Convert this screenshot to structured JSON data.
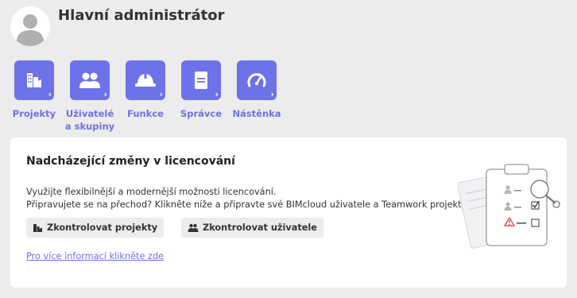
{
  "header": {
    "title": "Hlavní administrátor"
  },
  "nav": {
    "items": [
      {
        "label": "Projekty",
        "icon": "buildings-icon"
      },
      {
        "label": "Uživatelé a skupiny",
        "icon": "users-icon"
      },
      {
        "label": "Funkce",
        "icon": "hard-hat-icon"
      },
      {
        "label": "Správce",
        "icon": "server-icon"
      },
      {
        "label": "Nástěnka",
        "icon": "speedometer-icon"
      }
    ]
  },
  "license_card": {
    "title": "Nadcházející změny v licencování",
    "line1": "Využijte flexibilnější a modernější možnosti licencování.",
    "line2": "Připravujete se na přechod? Klikněte níže a připravte své BIMcloud uživatele a Teamwork projekty.",
    "check_projects_label": "Zkontrolovat projekty",
    "check_users_label": "Zkontrolovat uživatele",
    "more_info_link": "Pro více informací klikněte zde"
  },
  "colors": {
    "accent": "#6d72e8",
    "background": "#ececec",
    "card": "#ffffff",
    "warning": "#e05050"
  }
}
